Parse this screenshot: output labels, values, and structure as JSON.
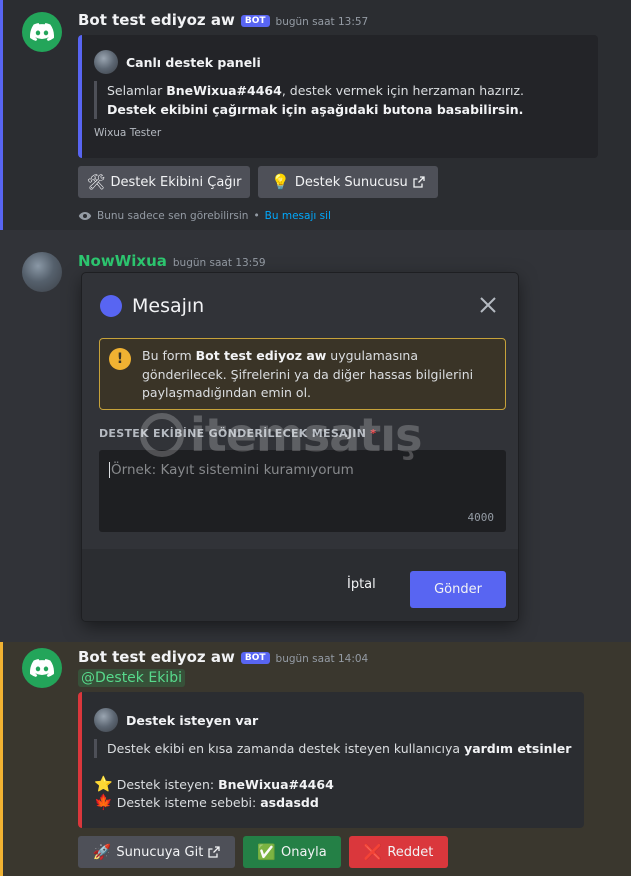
{
  "message1": {
    "username": "Bot test ediyoz aw",
    "badge": "BOT",
    "timestamp": "bugün saat 13:57",
    "embed": {
      "author": "Canlı destek paneli",
      "text_pre": "Selamlar ",
      "text_user": "BneWixua#4464",
      "text_mid": ", destek vermek için herzaman hazırız. ",
      "text_bold": "Destek ekibini çağırmak için aşağıdaki butona basabilirsin.",
      "footer": "Wixua Tester",
      "accent": "#5865f2"
    },
    "buttons": {
      "call_team": {
        "emoji": "🛠",
        "label": "Destek Ekibini Çağır"
      },
      "support_server": {
        "emoji": "💡",
        "label": "Destek Sunucusu"
      }
    },
    "ephemeral": {
      "text": "Bunu sadece sen görebilirsin",
      "separator": " • ",
      "dismiss": "Bu mesajı sil"
    }
  },
  "message2": {
    "username": "NowWixua",
    "timestamp": "bugün saat 13:59"
  },
  "modal": {
    "title": "Mesajın",
    "warning_pre": "Bu form ",
    "warning_app": "Bot test ediyoz aw",
    "warning_post": " uygulamasına gönderilecek. Şifrelerini ya da diğer hassas bilgilerini paylaşmadığından emin ol.",
    "field_label": "DESTEK EKİBİNE GÖNDERİLECEK MESAJIN",
    "required_mark": "*",
    "placeholder": "Örnek: Kayıt sistemini kuramıyorum",
    "char_limit": "4000",
    "cancel_label": "İptal",
    "submit_label": "Gönder"
  },
  "watermark": {
    "text": "itemsatış"
  },
  "message3": {
    "username": "Bot test ediyoz aw",
    "badge": "BOT",
    "timestamp": "bugün saat 14:04",
    "mention": "@Destek Ekibi",
    "embed": {
      "author": "Destek isteyen var",
      "quote_pre": "Destek ekibi en kısa zamanda destek isteyen kullanıcıya ",
      "quote_bold": "yardım etsinler",
      "requester_emoji": "⭐",
      "requester_label": "Destek isteyen: ",
      "requester_value": "BneWixua#4464",
      "reason_emoji": "🍁",
      "reason_label": "Destek isteme sebebi: ",
      "reason_value": "asdasdd",
      "accent": "#da373c"
    },
    "buttons": {
      "go_server": {
        "emoji": "🚀",
        "label": "Sunucuya Git"
      },
      "approve": {
        "emoji": "✅",
        "label": "Onayla"
      },
      "reject": {
        "emoji": "❌",
        "label": "Reddet"
      }
    }
  }
}
